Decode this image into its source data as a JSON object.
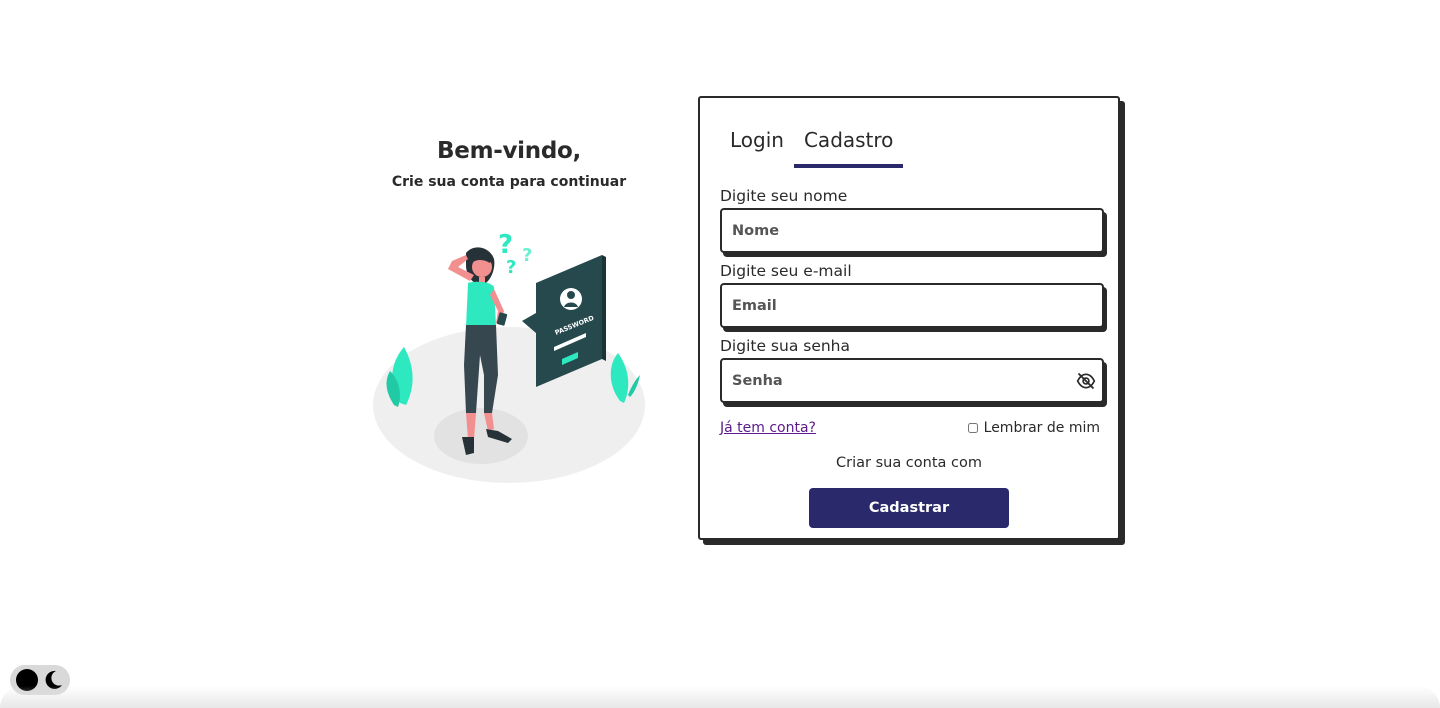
{
  "welcome": {
    "title": "Bem-vindo,",
    "subtitle": "Crie sua conta para continuar"
  },
  "illustration": {
    "sign_text": "PASSWORD"
  },
  "tabs": [
    {
      "label": "Login",
      "active": false
    },
    {
      "label": "Cadastro",
      "active": true
    }
  ],
  "form": {
    "name_label": "Digite seu nome",
    "name_placeholder": "Nome",
    "email_label": "Digite seu e-mail",
    "email_placeholder": "Email",
    "password_label": "Digite sua senha",
    "password_placeholder": "Senha",
    "password_toggle_icon": "eye-off-icon",
    "have_account_link": "Já tem conta?",
    "remember_label": "Lembrar de mim",
    "remember_checked": false,
    "create_with_text": "Criar sua conta com",
    "submit_label": "Cadastrar"
  },
  "theme_toggle": {
    "icons": [
      "sun-icon",
      "moon-icon"
    ]
  },
  "colors": {
    "primary": "#29296b",
    "text": "#2a2a2a",
    "accent": "#2ee8c0",
    "link": "#5a1a8a"
  }
}
